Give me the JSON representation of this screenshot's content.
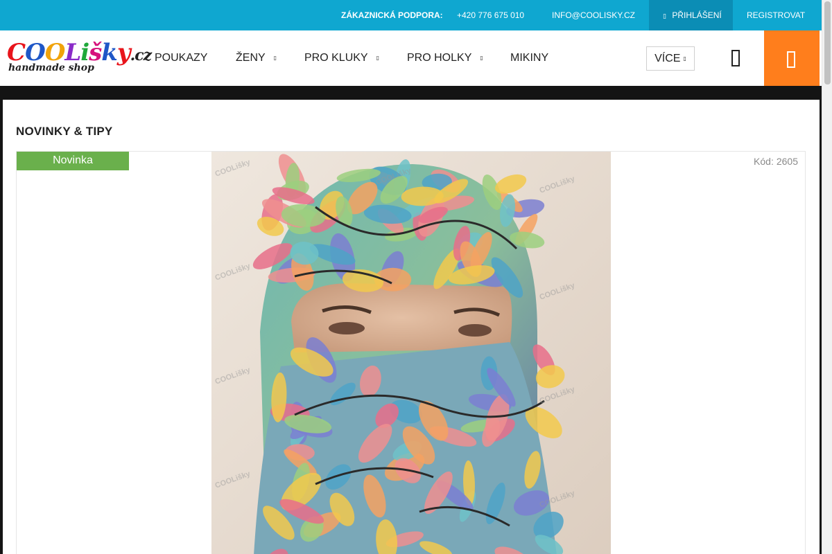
{
  "topbar": {
    "support_label": "ZÁKAZNICKÁ PODPORA:",
    "phone": "+420 776 675 010",
    "email": "INFO@COOLISKY.CZ",
    "login": "PŘIHLÁŠENÍ",
    "register": "REGISTROVAT"
  },
  "logo": {
    "letters": [
      "C",
      "O",
      "O",
      "L",
      "i",
      "š",
      "k",
      "y",
      ".cz"
    ],
    "colors": [
      "#e8141b",
      "#1f57c7",
      "#f0a30a",
      "#8a2bc8",
      "#1fa83a",
      "#d6127c",
      "#1f57c7",
      "#e8141b",
      "#222222"
    ],
    "tagline": "handmade shop"
  },
  "nav": {
    "items": [
      {
        "label": "POUKAZY",
        "has_submenu": false
      },
      {
        "label": "ŽENY",
        "has_submenu": true
      },
      {
        "label": "PRO KLUKY",
        "has_submenu": true
      },
      {
        "label": "PRO HOLKY",
        "has_submenu": true
      },
      {
        "label": "MIKINY",
        "has_submenu": false
      }
    ],
    "more": "VÍCE",
    "search_icon": "search-icon",
    "cart_icon": "cart-icon"
  },
  "section": {
    "title": "NOVINKY & TIPY"
  },
  "product": {
    "badge": "Novinka",
    "code_label": "Kód:",
    "code_value": "2605",
    "watermark": "COOLišky",
    "image_subject": "balaclava with leaf print on mannequin"
  },
  "colors": {
    "topbar": "#0fa7d0",
    "topbar_login": "#0b8db5",
    "cart": "#ff7e1c",
    "badge": "#6ab04c",
    "band": "#141414"
  }
}
